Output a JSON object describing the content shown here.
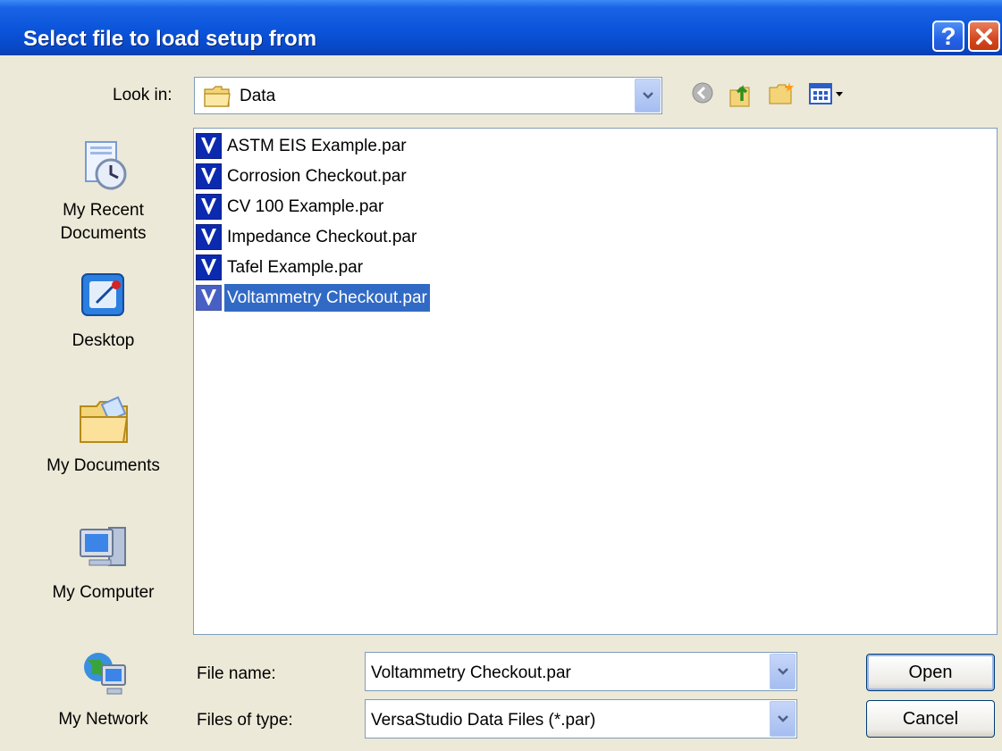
{
  "window": {
    "title": "Select file to load setup from"
  },
  "title_buttons": {
    "help": "?",
    "close": "✕"
  },
  "lookin": {
    "label": "Look in:",
    "value": "Data"
  },
  "toolbar": {
    "icons": [
      "back-icon",
      "up-folder-icon",
      "new-folder-icon",
      "view-menu-icon"
    ]
  },
  "places": [
    {
      "label": "My Recent Documents",
      "line1": "My Recent",
      "line2": "Documents",
      "icon": "recent-documents-icon"
    },
    {
      "label": "Desktop",
      "icon": "desktop-icon"
    },
    {
      "label": "My Documents",
      "icon": "my-documents-icon"
    },
    {
      "label": "My Computer",
      "icon": "my-computer-icon"
    },
    {
      "label": "My Network",
      "icon": "my-network-icon"
    }
  ],
  "files": [
    {
      "name": "ASTM EIS Example.par",
      "selected": false
    },
    {
      "name": "Corrosion Checkout.par",
      "selected": false
    },
    {
      "name": "CV 100 Example.par",
      "selected": false
    },
    {
      "name": "Impedance Checkout.par",
      "selected": false
    },
    {
      "name": "Tafel Example.par",
      "selected": false
    },
    {
      "name": "Voltammetry Checkout.par",
      "selected": true
    }
  ],
  "filename": {
    "label": "File name:",
    "value": "Voltammetry Checkout.par"
  },
  "filetype": {
    "label": "Files of type:",
    "value": "VersaStudio Data Files (*.par)"
  },
  "buttons": {
    "open": "Open",
    "cancel": "Cancel"
  },
  "colors": {
    "selection": "#316ac5",
    "titlebar": "#0a54da",
    "dialog_bg": "#ece9d8"
  }
}
